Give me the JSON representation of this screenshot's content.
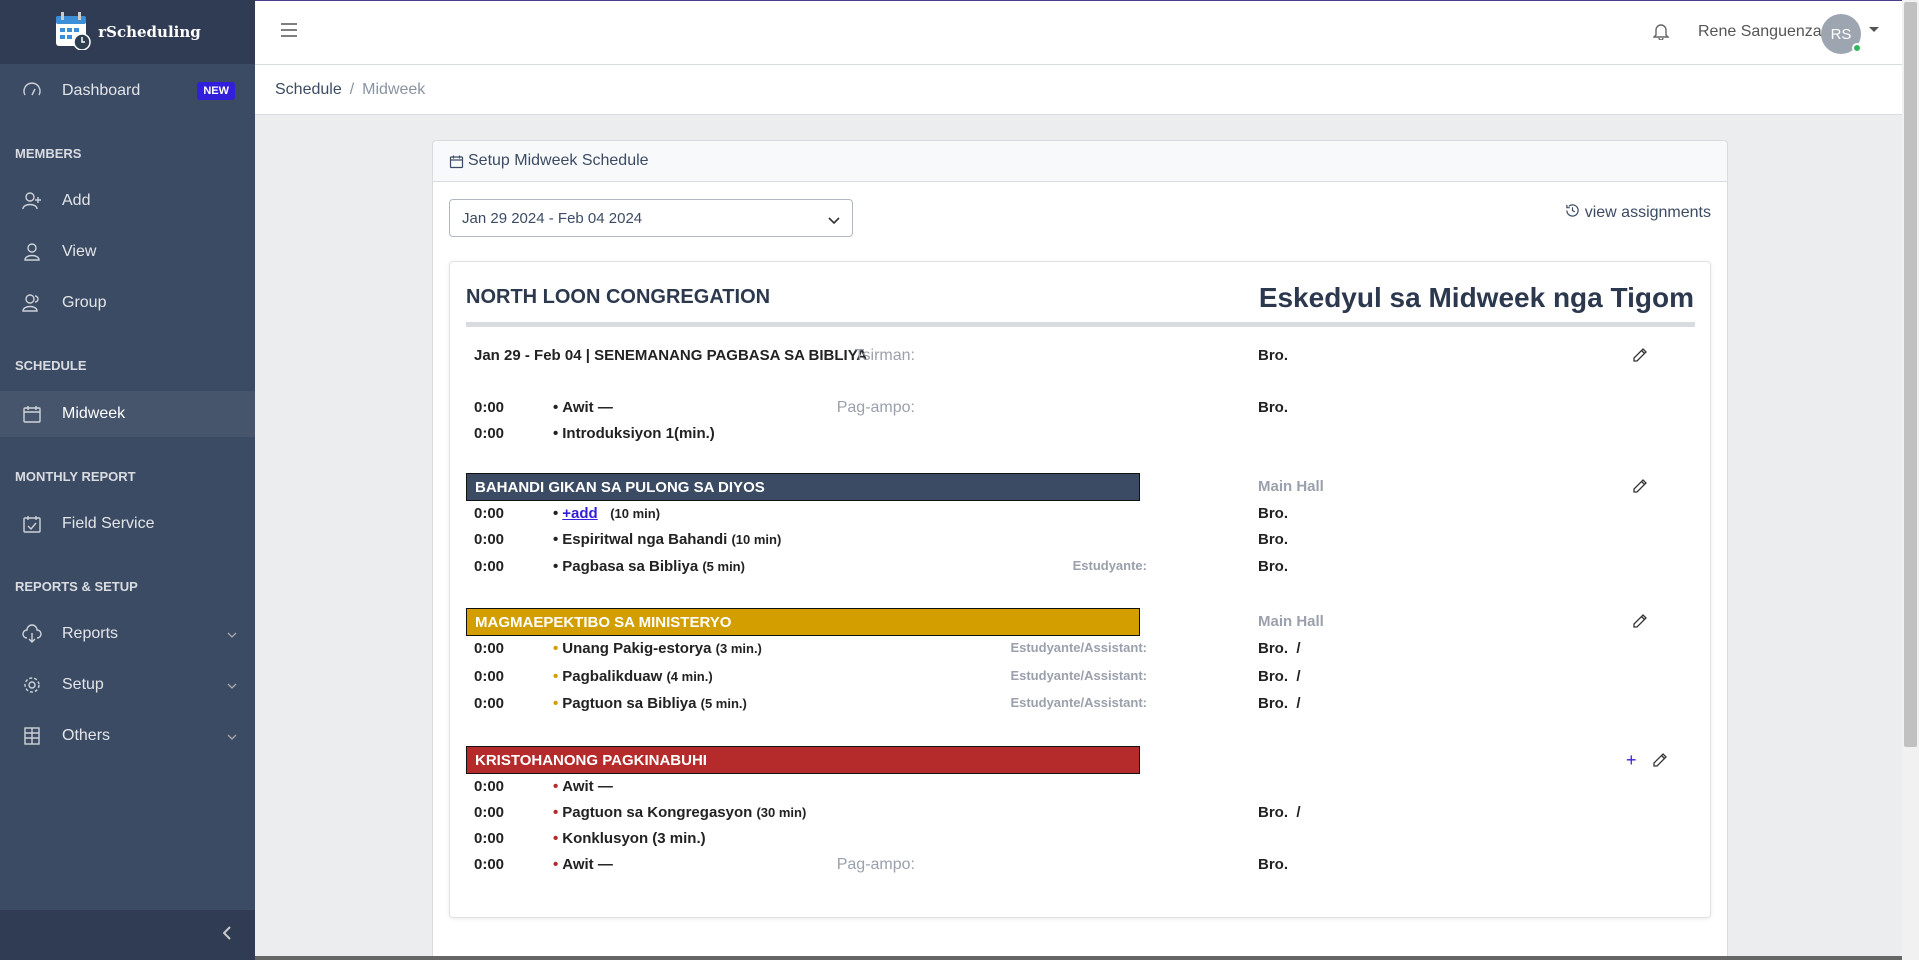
{
  "app": {
    "brand": "rScheduling"
  },
  "sidebar": {
    "dashboard": "Dashboard",
    "new_badge": "NEW",
    "members_title": "MEMBERS",
    "add": "Add",
    "view": "View",
    "group": "Group",
    "schedule_title": "SCHEDULE",
    "midweek": "Midweek",
    "monthly_title": "MONTHLY REPORT",
    "field_service": "Field Service",
    "reports_title": "REPORTS & SETUP",
    "reports": "Reports",
    "setup": "Setup",
    "others": "Others"
  },
  "header": {
    "user_name": "Rene Sanguenza",
    "avatar_initials": "RS"
  },
  "breadcrumb": {
    "root": "Schedule",
    "sep": "/",
    "current": "Midweek"
  },
  "card": {
    "title": "Setup Midweek Schedule",
    "week_select": "Jan 29 2024 - Feb 04 2024",
    "view_assignments": "view assignments"
  },
  "schedule": {
    "congregation": "NORTH LOON CONGREGATION",
    "title": "Eskedyul sa Midweek nga Tigom",
    "week_heading": "Jan 29 - Feb 04 | SENEMANANG PAGBASA SA BIBLIYA",
    "chairman_label": "Tsirman:",
    "chairman_value": "Bro.",
    "opening": [
      {
        "time": "0:00",
        "item": "Awit —",
        "label": "Pag-ampo:",
        "value": "Bro."
      },
      {
        "time": "0:00",
        "item": "Introduksiyon 1(min.)"
      }
    ],
    "sections": {
      "treasures": {
        "title": "BAHANDI GIKAN SA PULONG SA DIYOS",
        "hall": "Main Hall",
        "color": "#3c4b64",
        "rows": [
          {
            "time": "0:00",
            "link": "+add",
            "dur": "(10 min)",
            "value": "Bro."
          },
          {
            "time": "0:00",
            "item": "Espiritwal nga Bahandi",
            "dur": "(10 min)",
            "value": "Bro."
          },
          {
            "time": "0:00",
            "item": "Pagbasa sa Bibliya",
            "dur": "(5 min)",
            "label": "Estudyante:",
            "value": "Bro."
          }
        ]
      },
      "ministry": {
        "title": "MAGMAEPEKTIBO SA MINISTERYO",
        "hall": "Main Hall",
        "color": "#d39e00",
        "rows": [
          {
            "time": "0:00",
            "item": "Unang Pakig-estorya",
            "dur": "(3 min.)",
            "label": "Estudyante/Assistant:",
            "value": "Bro.  /"
          },
          {
            "time": "0:00",
            "item": "Pagbalikduaw",
            "dur": "(4 min.)",
            "label": "Estudyante/Assistant:",
            "value": "Bro.  /"
          },
          {
            "time": "0:00",
            "item": "Pagtuon sa Bibliya",
            "dur": "(5 min.)",
            "label": "Estudyante/Assistant:",
            "value": "Bro.  /"
          }
        ]
      },
      "living": {
        "title": "KRISTOHANONG PAGKINABUHI",
        "color": "#b52a2a",
        "plus": "+",
        "rows": [
          {
            "time": "0:00",
            "item": "Awit —"
          },
          {
            "time": "0:00",
            "item": "Pagtuon sa Kongregasyon",
            "dur": "(30 min)",
            "value": "Bro.  /"
          },
          {
            "time": "0:00",
            "item": "Konklusyon (3 min.)"
          },
          {
            "time": "0:00",
            "item": "Awit —",
            "label": "Pag-ampo:",
            "value": "Bro."
          }
        ]
      }
    },
    "bullet": "•"
  },
  "colors": {
    "sidebar": "#3c4b64",
    "accent": "#321fdb",
    "gold": "#d39e00",
    "red": "#b52a2a"
  },
  "icons": [
    "calendar-clock-logo",
    "speedometer-icon",
    "user-add-icon",
    "user-icon",
    "people-icon",
    "calendar-icon",
    "calendar-check-icon",
    "cloud-download-icon",
    "gear-icon",
    "building-icon",
    "chevron-left-icon",
    "hamburger-icon",
    "bell-icon",
    "pencil-icon",
    "history-icon"
  ]
}
